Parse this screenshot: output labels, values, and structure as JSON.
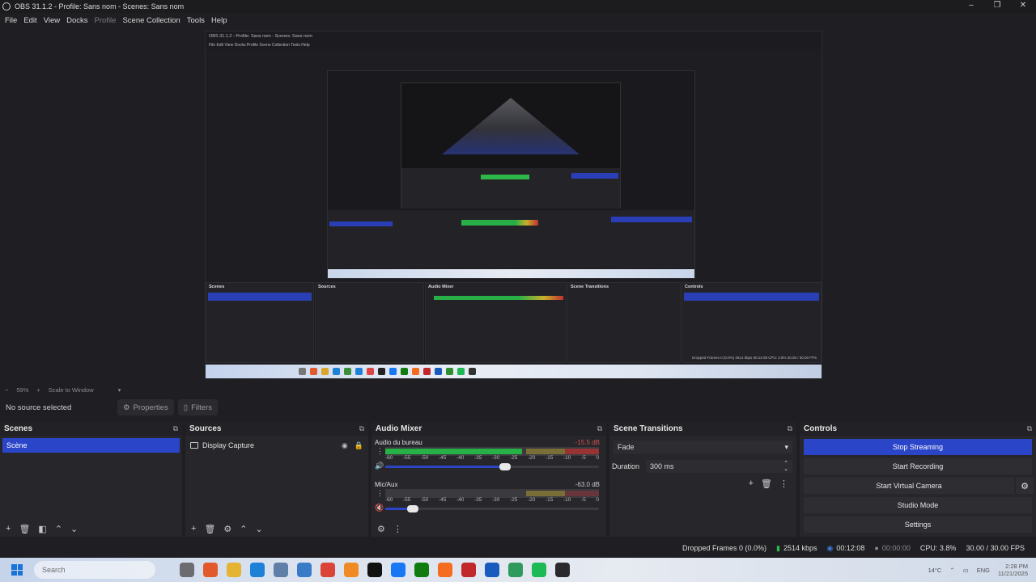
{
  "window": {
    "title": "OBS 31.1.2 - Profile: Sans nom - Scenes: Sans nom",
    "controls": [
      "–",
      "❐",
      "✕"
    ]
  },
  "menu": [
    "File",
    "Edit",
    "View",
    "Docks",
    "Profile",
    "Scene Collection",
    "Tools",
    "Help"
  ],
  "preview": {
    "zoom": "59%",
    "scale_mode": "Scale to Window",
    "nested": {
      "title": "OBS 31.1.2 - Profile: Sans nom - Scenes: Sans nom",
      "menu": "File  Edit  View  Docks  Profile  Scene Collection  Tools  Help",
      "nosource": "No source selected",
      "status": "Dropped Frames 0 (0.0%)   2514 kbps   00:12:08   CPU: 3.8%   30.00 / 30.00 FPS",
      "docks": [
        "Scenes",
        "Sources",
        "Audio Mixer",
        "Scene Transitions",
        "Controls"
      ]
    }
  },
  "source_toolbar": {
    "no_source": "No source selected",
    "properties": "Properties",
    "filters": "Filters"
  },
  "scenes": {
    "title": "Scenes",
    "items": [
      "Scène"
    ]
  },
  "sources": {
    "title": "Sources",
    "items": [
      {
        "label": "Display Capture"
      }
    ]
  },
  "mixer": {
    "title": "Audio Mixer",
    "ticks": [
      "-60",
      "-55",
      "-50",
      "-45",
      "-40",
      "-35",
      "-30",
      "-25",
      "-20",
      "-15",
      "-10",
      "-5",
      "0"
    ],
    "channels": [
      {
        "name": "Audio du bureau",
        "db": "-15.5 dB",
        "level": 0.64,
        "volume": 0.56,
        "db_color": "#d25050"
      },
      {
        "name": "Mic/Aux",
        "db": "-63.0 dB",
        "level": 0.0,
        "volume": 0.13,
        "db_color": "#c8c8c8"
      }
    ]
  },
  "transitions": {
    "title": "Scene Transitions",
    "type": "Fade",
    "duration_label": "Duration",
    "duration_value": "300 ms"
  },
  "controls": {
    "title": "Controls",
    "buttons": [
      "Stop Streaming",
      "Start Recording",
      "Start Virtual Camera",
      "Studio Mode",
      "Settings"
    ]
  },
  "status": {
    "dropped": "Dropped Frames 0 (0.0%)",
    "bitrate": "2514 kbps",
    "stream_time": "00:12:08",
    "rec_time": "00:00:00",
    "cpu": "CPU: 3.8%",
    "fps": "30.00 / 30.00 FPS"
  },
  "taskbar": {
    "search_placeholder": "Search",
    "lang": "ENG",
    "time": "2:28 PM",
    "date": "11/21/2025",
    "weather": "14°C"
  },
  "colors": {
    "accent": "#2b45c9",
    "meter_green": "#27b046",
    "meter_yellow": "#c8b02a",
    "meter_red": "#c03030"
  }
}
